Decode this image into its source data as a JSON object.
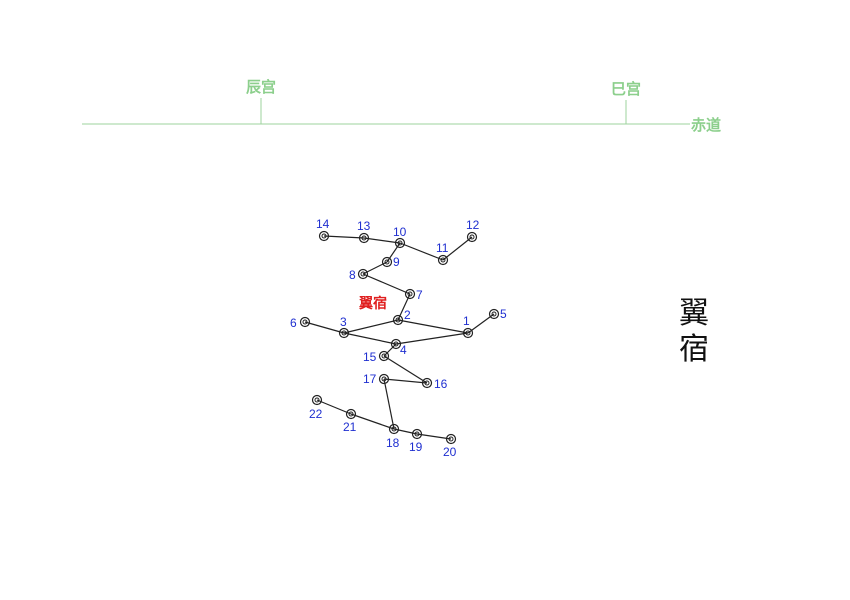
{
  "palaces": [
    "辰宫",
    "巳宫"
  ],
  "equator_label": "赤道",
  "asterism_label": "翼宿",
  "title_chars": [
    "翼",
    "宿"
  ],
  "stars": [
    "1",
    "2",
    "3",
    "4",
    "5",
    "6",
    "7",
    "8",
    "9",
    "10",
    "11",
    "12",
    "13",
    "14",
    "15",
    "16",
    "17",
    "18",
    "19",
    "20",
    "21",
    "22"
  ],
  "colors": {
    "green": "#8ccf8c",
    "line_green": "#9ed39e",
    "number_blue": "#1f2fd0",
    "label_red": "#e02020",
    "star": "#222222"
  }
}
